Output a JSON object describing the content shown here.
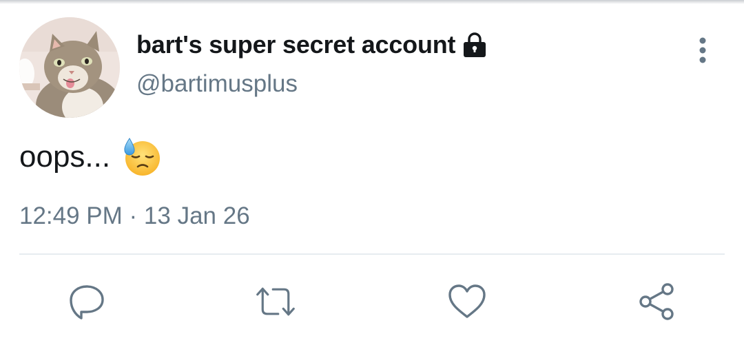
{
  "tweet": {
    "display_name": "bart's super secret account",
    "handle": "@bartimusplus",
    "text": "oops...",
    "time": "12:49 PM",
    "separator": " · ",
    "date": "13 Jan 26",
    "emoji": "downcast-face-with-sweat"
  },
  "icons": {
    "lock": "lock-icon",
    "more": "more-vertical-icon",
    "reply": "reply-icon",
    "retweet": "retweet-icon",
    "like": "heart-icon",
    "share": "share-icon"
  },
  "colors": {
    "text": "#14171a",
    "secondary": "#657786",
    "divider": "#e6ecf0"
  }
}
